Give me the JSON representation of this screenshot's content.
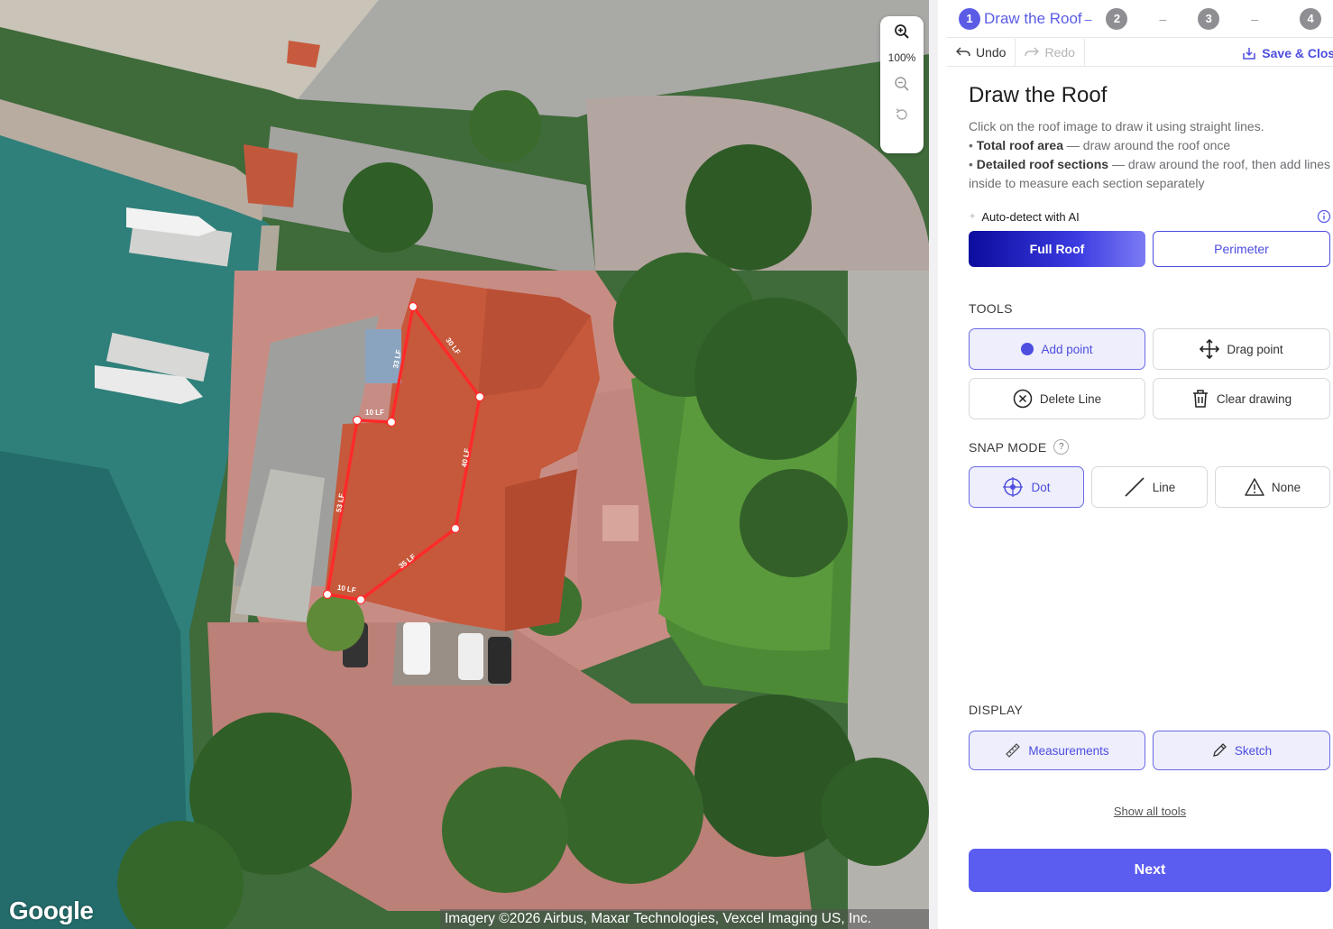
{
  "map": {
    "zoom_level": "100%",
    "google_logo": "Google",
    "attribution": "Imagery ©2026 Airbus, Maxar Technologies, Vexcel Imaging US, Inc.",
    "measurements": [
      "33 LF",
      "10 LF",
      "53 LF",
      "10 LF",
      "35 LF",
      "40 LF",
      "30 LF"
    ]
  },
  "stepper": {
    "steps": [
      {
        "num": "1",
        "label": "Draw the Roof",
        "active": true
      },
      {
        "num": "2",
        "active": false
      },
      {
        "num": "3",
        "active": false
      },
      {
        "num": "4",
        "active": false
      }
    ],
    "dash": "–"
  },
  "toolbar": {
    "undo": "Undo",
    "redo": "Redo",
    "save_close": "Save & Close"
  },
  "content": {
    "title": "Draw the Roof",
    "intro": "Click on the roof image to draw it using straight lines.",
    "bullet1_bold": "Total roof area",
    "bullet1_rest": " — draw around the roof once",
    "bullet2_bold": "Detailed roof sections",
    "bullet2_rest": " — draw around the roof, then add lines inside to measure each section separately",
    "ai_label": "Auto-detect with AI",
    "full_roof": "Full Roof",
    "perimeter": "Perimeter"
  },
  "tools": {
    "heading": "TOOLS",
    "add_point": "Add point",
    "drag_point": "Drag point",
    "delete_line": "Delete Line",
    "clear_drawing": "Clear drawing"
  },
  "snap": {
    "heading": "SNAP MODE",
    "help": "?",
    "dot": "Dot",
    "line": "Line",
    "none": "None"
  },
  "display": {
    "heading": "DISPLAY",
    "measurements": "Measurements",
    "sketch": "Sketch"
  },
  "footer": {
    "show_all": "Show all tools",
    "next": "Next"
  },
  "colors": {
    "accent": "#5b5ce6",
    "roof_line": "#ff2a2a"
  }
}
